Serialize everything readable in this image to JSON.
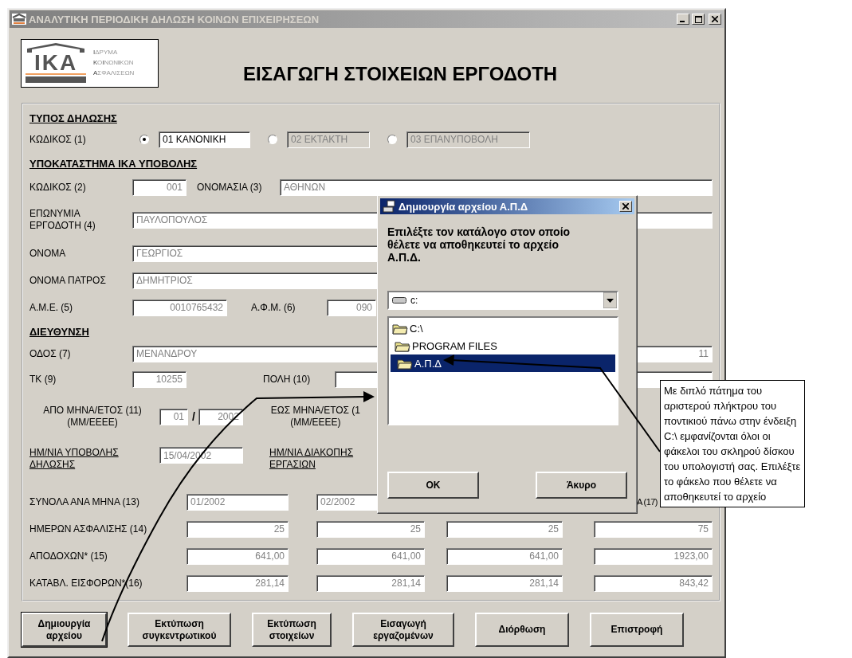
{
  "window": {
    "title": "ΑΝΑΛΥΤΙΚΗ ΠΕΡΙΟΔΙΚΗ ΔΗΛΩΣΗ ΚΟΙΝΩΝ ΕΠΙΧΕΙΡΗΣΕΩΝ"
  },
  "logo": {
    "mark": "ΙΚΑ",
    "lines": [
      "**Ι**ΔΡΥΜΑ",
      "**Κ**Ο**Ι**ΝΩΝ**Ι**ΚΩΝ",
      "**Α**ΣΦΑΛΙΣΕΩΝ"
    ]
  },
  "heading": "ΕΙΣΑΓΩΓΗ ΣΤΟΙΧΕΙΩΝ ΕΡΓΟΔΟΤΗ",
  "declaration": {
    "heading": "ΤΥΠΟΣ ΔΗΛΩΣΗΣ",
    "label": "ΚΩΔΙΚΟΣ (1)",
    "options": [
      {
        "label": "01 ΚΑΝΟΝΙΚΗ",
        "selected": true
      },
      {
        "label": "02 ΕΚΤΑΚΤΗ",
        "selected": false
      },
      {
        "label": "03 ΕΠΑΝΥΠΟΒΟΛΗ",
        "selected": false
      }
    ]
  },
  "branch": {
    "heading": "ΥΠΟΚΑΤΑΣΤΗΜΑ ΙΚΑ ΥΠΟΒΟΛΗΣ",
    "code_label": "ΚΩΔΙΚΟΣ (2)",
    "code": "001",
    "name_label": "ΟΝΟΜΑΣΙΑ (3)",
    "name": "ΑΘΗΝΩΝ"
  },
  "employer": {
    "surname_label": [
      "ΕΠΩΝΥΜΙΑ",
      "ΕΡΓΟΔΟΤΗ (4)"
    ],
    "surname": "ΠΑΥΛΟΠΟΥΛΟΣ",
    "first_name_label": "ΟΝΟΜΑ",
    "first_name": "ΓΕΩΡΓΙΟΣ",
    "father_label": "ΟΝΟΜΑ ΠΑΤΡΟΣ",
    "father": "ΔΗΜΗΤΡΙΟΣ",
    "ame_label": "Α.Μ.Ε. (5)",
    "ame": "0010765432",
    "afm_label": "Α.Φ.Μ. (6)",
    "afm": "090"
  },
  "address": {
    "heading": "ΔΙΕΥΘΥΝΣΗ",
    "street_label": "ΟΔΟΣ (7)",
    "street": "ΜΕΝΑΝΔΡΟΥ",
    "number": "11",
    "postcode_label": "ΤΚ (9)",
    "postcode": "10255",
    "city_label": "ΠΟΛΗ (10)"
  },
  "period": {
    "from_label": [
      "ΑΠΟ ΜΗΝΑ/ΕΤΟΣ (11)",
      "(ΜΜ/ΕΕΕΕ)"
    ],
    "from_month": "01",
    "separator": "/",
    "from_year": "2002",
    "to_label": [
      "ΕΩΣ ΜΗΝΑ/ΕΤΟΣ (1",
      "(ΜΜ/ΕΕΕΕ)"
    ]
  },
  "dates": {
    "submission_label": [
      "ΗΜ/ΝΙΑ ΥΠΟΒΟΛΗΣ",
      "ΔΗΛΩΣΗΣ"
    ],
    "submission": "15/04/2002",
    "stop_label": [
      "ΗΜ/ΝΙΑ ΔΙΑΚΟΠΗΣ",
      "ΕΡΓΑΣΙΩΝ"
    ]
  },
  "totals": {
    "months_label": "ΣΥΝΟΛΑ ΑΝΑ ΜΗΝΑ (13)",
    "months": [
      "01/2002",
      "02/2002"
    ],
    "total_label": "Α (17)",
    "rows": [
      {
        "label": "ΗΜΕΡΩΝ ΑΣΦΑΛΙΣΗΣ (14)",
        "values": [
          "25",
          "25",
          "25",
          "75"
        ]
      },
      {
        "label": "ΑΠΟΔΟΧΩΝ* (15)",
        "values": [
          "641,00",
          "641,00",
          "641,00",
          "1923,00"
        ]
      },
      {
        "label": "ΚΑΤΑΒΛ. ΕΙΣΦΟΡΩΝ*(16)",
        "values": [
          "281,14",
          "281,14",
          "281,14",
          "843,42"
        ]
      }
    ]
  },
  "buttons": [
    [
      "Δημιουργία",
      "αρχείου"
    ],
    [
      "Εκτύπωση",
      "συγκεντρωτικού"
    ],
    [
      "Εκτύπωση",
      "στοιχείων"
    ],
    [
      "Εισαγωγή",
      "εργαζομένων"
    ],
    [
      "Διόρθωση"
    ],
    [
      "Επιστροφή"
    ]
  ],
  "dialog": {
    "title": "Δημιουργία αρχείου Α.Π.Δ",
    "message": "Επιλέξτε τον κατάλογο στον οποίο θέλετε να αποθηκευτεί το αρχείο Α.Π.Δ.",
    "drive": "c:",
    "folders": [
      {
        "name": "C:\\",
        "selected": false,
        "children": [
          {
            "name": "PROGRAM FILES",
            "selected": false,
            "children": [
              {
                "name": "Α.Π.Δ",
                "selected": true
              }
            ]
          }
        ]
      }
    ],
    "buttons": [
      "OK",
      "Άκυρο"
    ]
  },
  "callout": "Με διπλό πάτημα του αριστερού πλήκτρου του ποντικιού πάνω στην ένδειξη C:\\ εμφανίζονται όλοι οι φάκελοι του σκληρού δίσκου του υπολογιστή σας. Επιλέξτε το φάκελο που θέλετε να αποθηκευτεί το αρχείο"
}
